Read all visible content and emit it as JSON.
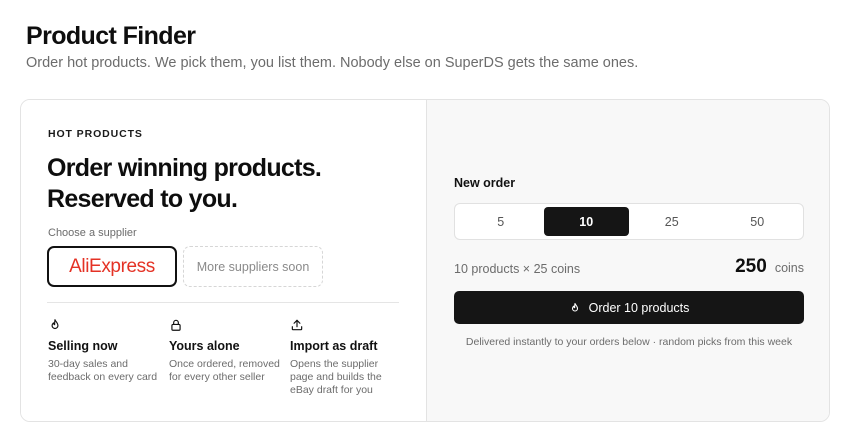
{
  "header": {
    "title": "Product Finder",
    "subtitle": "Order hot products. We pick them, you list them. Nobody else on SuperDS gets the same ones."
  },
  "hot_products": {
    "eyebrow": "HOT PRODUCTS",
    "headline_line1": "Order winning products.",
    "headline_line2": "Reserved to you.",
    "supplier_label": "Choose a supplier",
    "suppliers": [
      {
        "name": "AliExpress",
        "selected": true
      },
      {
        "name": "More suppliers soon",
        "selected": false
      }
    ],
    "features": [
      {
        "icon": "flame-icon",
        "title": "Selling now",
        "desc": "30-day sales and feedback on every card"
      },
      {
        "icon": "lock-icon",
        "title": "Yours alone",
        "desc": "Once ordered, removed for every other seller"
      },
      {
        "icon": "upload-icon",
        "title": "Import as draft",
        "desc": "Opens the supplier page and builds the eBay draft for you"
      }
    ]
  },
  "new_order": {
    "label": "New order",
    "quantities": [
      "5",
      "10",
      "25",
      "50"
    ],
    "selected_quantity": "10",
    "calc_text": "10 products × 25 coins",
    "total_coins": "250",
    "coins_unit": "coins",
    "button_label": "Order 10 products",
    "button_icon": "flame-icon",
    "note": "Delivered instantly to your orders below · random picks from this week"
  },
  "colors": {
    "accent_dark": "#151515",
    "aliexpress_brand": "#e43225",
    "muted_text": "#6c6c6c",
    "right_panel_bg": "#f8f8f8"
  }
}
